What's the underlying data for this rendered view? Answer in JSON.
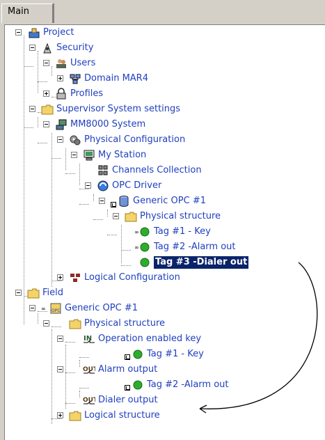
{
  "tab": {
    "label": "Main"
  },
  "tree": {
    "project": "Project",
    "security": "Security",
    "users": "Users",
    "domain": "Domain MAR4",
    "profiles": "Profiles",
    "supervisor": "Supervisor System settings",
    "mm8000": "MM8000 System",
    "physical_config": "Physical Configuration",
    "my_station": "My Station",
    "channels": "Channels Collection",
    "opc_driver": "OPC Driver",
    "generic_opc": "Generic OPC #1",
    "physical_structure": "Physical structure",
    "tag1": "Tag #1 - Key",
    "tag2": "Tag #2 -Alarm out",
    "tag3": "Tag #3 -Dialer out",
    "logical_config": "Logical Configuration",
    "field": "Field",
    "field_generic_opc": "Generic OPC #1",
    "field_physical_structure": "Physical structure",
    "op_enabled_key": "Operation enabled key",
    "field_tag1": "Tag #1 - Key",
    "alarm_output": "Alarm output",
    "field_tag2": "Tag #2 -Alarm out",
    "dialer_output": "Dialer output",
    "logical_structure": "Logical structure"
  },
  "colors": {
    "label": "#1f3fbf",
    "selection": "#0a246a",
    "folder": "#f4d36a",
    "green_dot": "#2cae2c"
  }
}
